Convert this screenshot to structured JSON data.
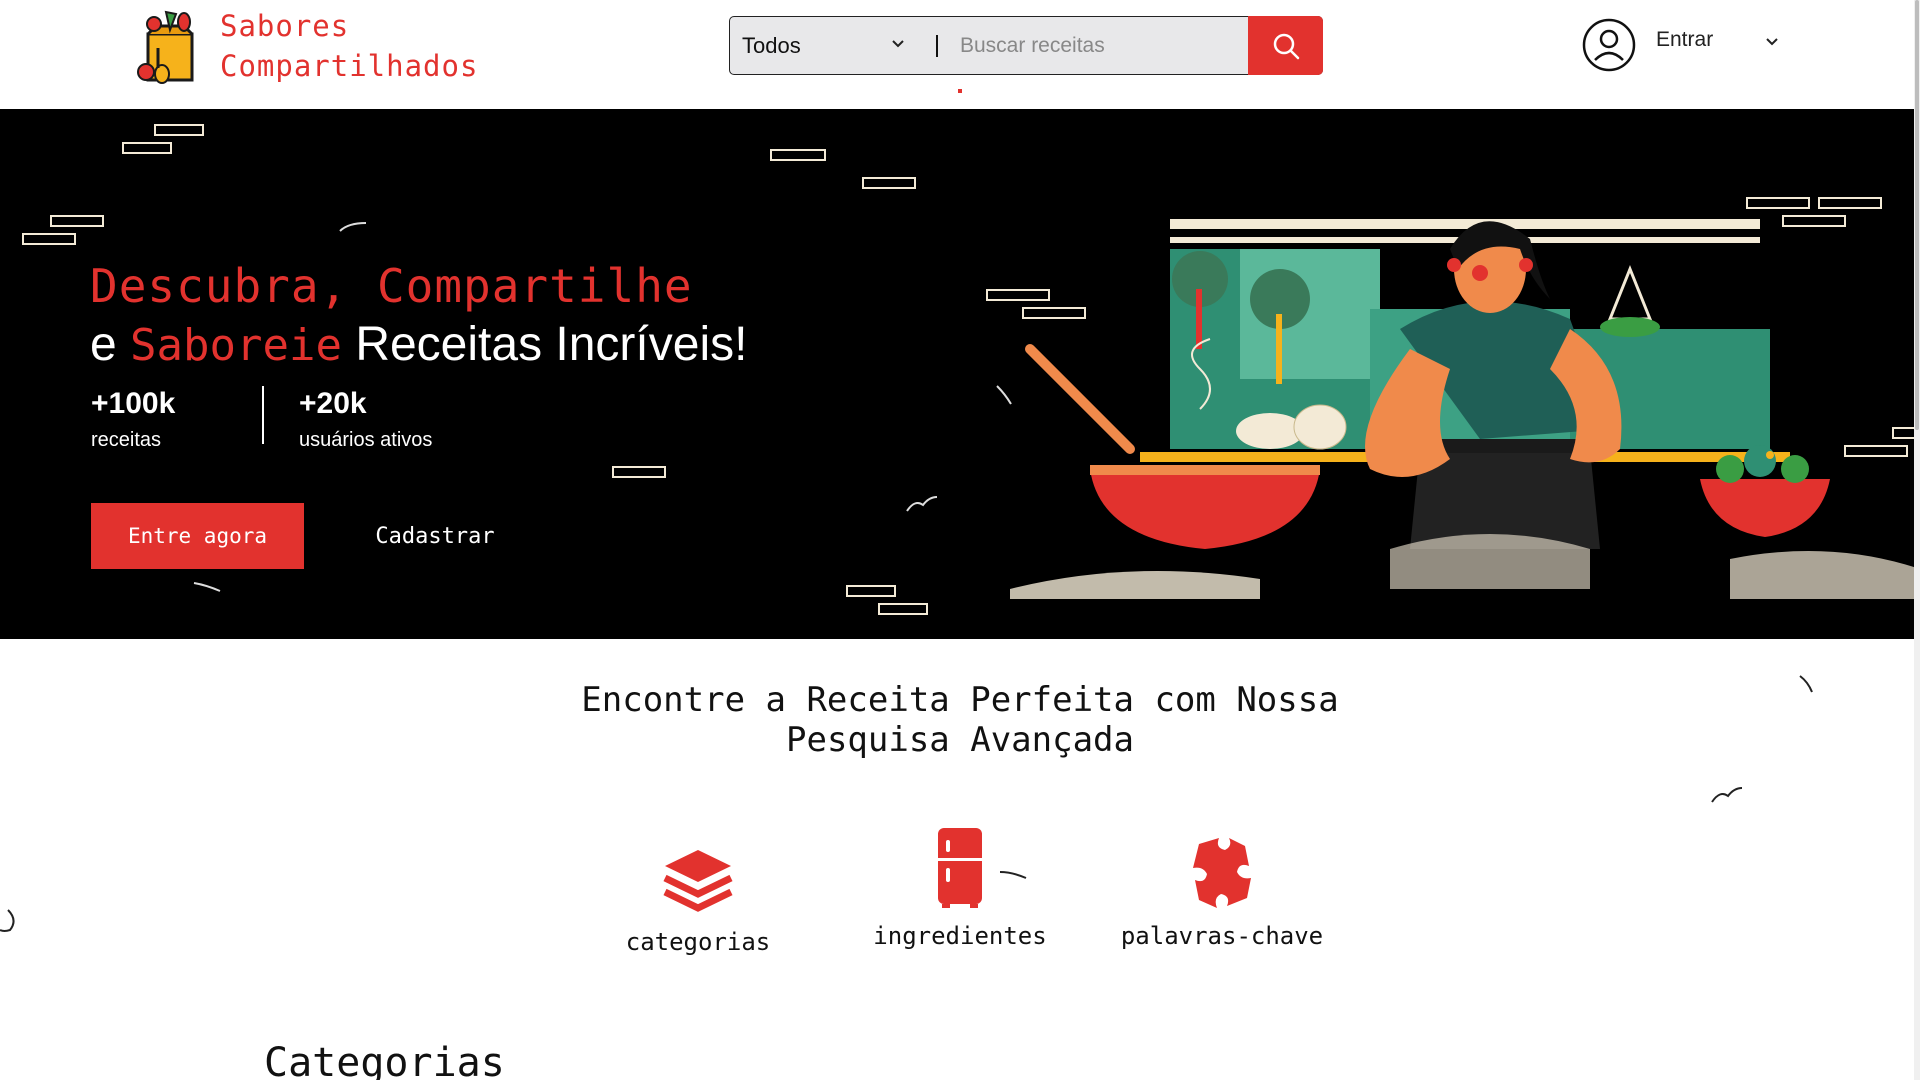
{
  "header": {
    "brand_line1": "Sabores",
    "brand_line2": "Compartilhados",
    "search": {
      "category_selected": "Todos",
      "placeholder": "Buscar receitas"
    },
    "login_label": "Entrar"
  },
  "hero": {
    "title_line1": "Descubra, Compartilhe",
    "title_line2_prefix": "e",
    "title_line2_accent": "Saboreie",
    "title_line2_suffix": "Receitas Incríveis!",
    "stats": [
      {
        "value": "+100k",
        "label": "receitas"
      },
      {
        "value": "+20k",
        "label": "usuários ativos"
      }
    ],
    "primary_button": "Entre agora",
    "secondary_button": "Cadastrar"
  },
  "advanced_search": {
    "title": "Encontre a Receita Perfeita com Nossa Pesquisa Avançada",
    "features": [
      {
        "icon": "layers-icon",
        "label": "categorias"
      },
      {
        "icon": "fridge-icon",
        "label": "ingredientes"
      },
      {
        "icon": "puzzle-icon",
        "label": "palavras-chave"
      }
    ]
  },
  "categories": {
    "heading": "Categorias"
  },
  "colors": {
    "accent": "#e2322e",
    "hero_bg": "#000000",
    "brick": "#f3ead6"
  }
}
